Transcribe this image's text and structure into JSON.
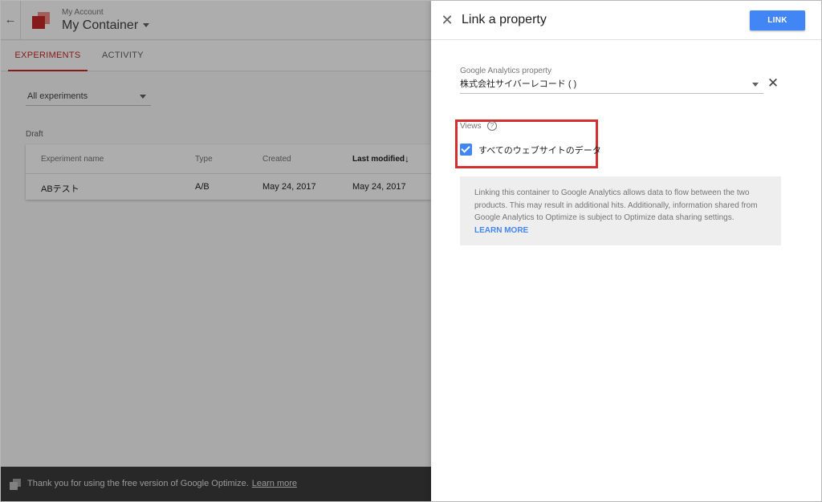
{
  "header": {
    "account": "My Account",
    "container": "My Container"
  },
  "tabs": [
    {
      "label": "EXPERIMENTS",
      "active": true
    },
    {
      "label": "ACTIVITY",
      "active": false
    }
  ],
  "filter": {
    "value": "All experiments"
  },
  "section_label": "Draft",
  "table": {
    "columns": [
      "Experiment name",
      "Type",
      "Created",
      "Last modified"
    ],
    "rows": [
      [
        "ABテスト",
        "A/B",
        "May 24, 2017",
        "May 24, 2017"
      ]
    ]
  },
  "footer": {
    "text": "Thank you for using the free version of Google Optimize.",
    "link": "Learn more"
  },
  "panel": {
    "title": "Link a property",
    "link_button": "LINK",
    "property_label": "Google Analytics property",
    "property_value": "株式会社サイバーレコード (                      )",
    "views_label": "Views",
    "view_option": "すべてのウェブサイトのデータ",
    "view_checked": true,
    "info_text": "Linking this container to Google Analytics allows data to flow between the two products. This may result in additional hits. Additionally, information shared from Google Analytics to Optimize is subject to Optimize data sharing settings.",
    "learn_more": "LEARN MORE"
  },
  "colors": {
    "accent_red": "#c62828",
    "primary_blue": "#4285f4",
    "highlight": "#d32f2f"
  }
}
